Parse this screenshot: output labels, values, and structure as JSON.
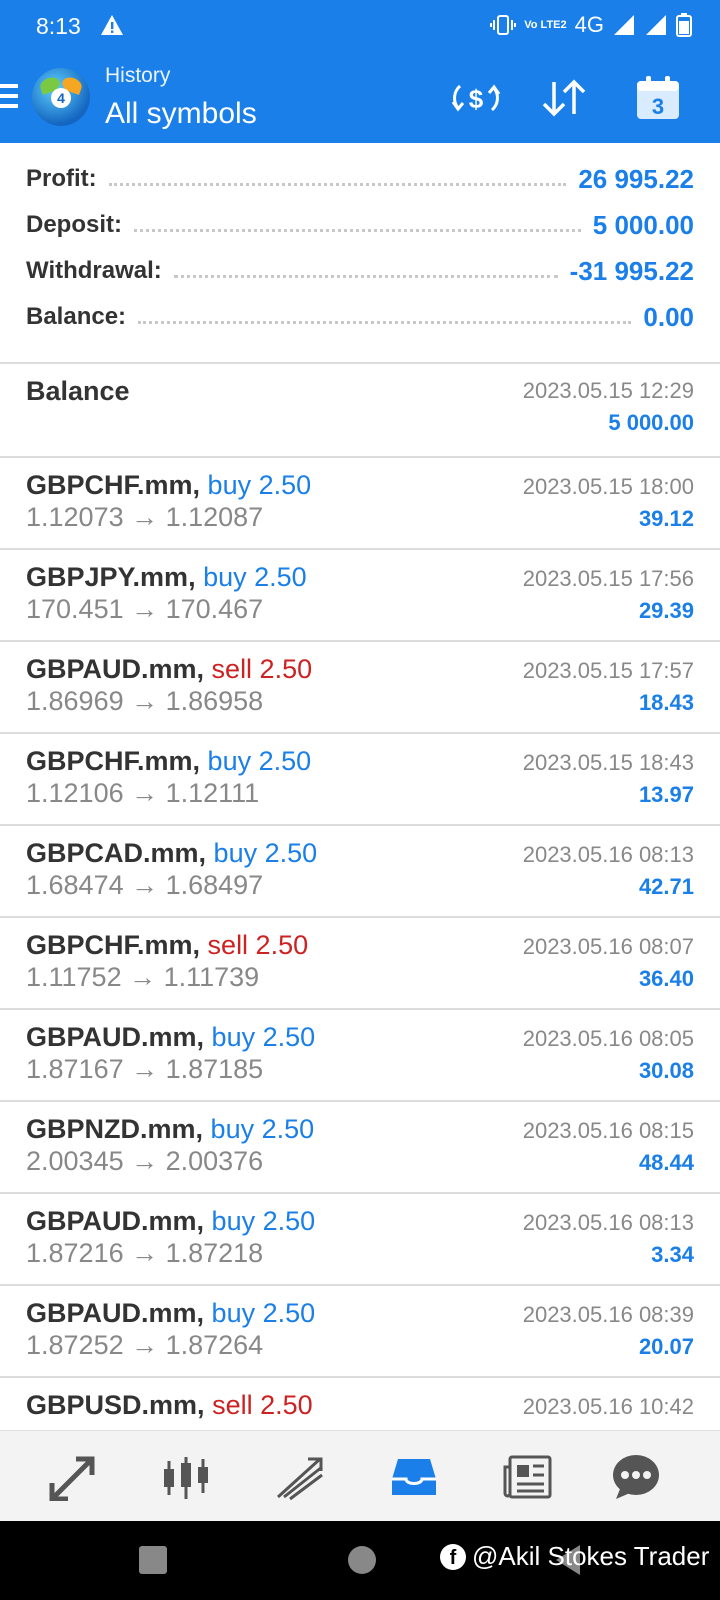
{
  "status_bar": {
    "time": "8:13",
    "network": "4G",
    "volte": "Vo LTE2"
  },
  "header": {
    "subtitle": "History",
    "title": "All symbols",
    "calendar_day": "3"
  },
  "summary": [
    {
      "label": "Profit:",
      "value": "26 995.22"
    },
    {
      "label": "Deposit:",
      "value": "5 000.00"
    },
    {
      "label": "Withdrawal:",
      "value": "-31 995.22"
    },
    {
      "label": "Balance:",
      "value": "0.00"
    }
  ],
  "balance_entry": {
    "title": "Balance",
    "time": "2023.05.15 12:29",
    "amount": "5 000.00"
  },
  "deals": [
    {
      "symbol": "GBPCHF.mm,",
      "side": "buy 2.50",
      "type": "buy",
      "prices": "1.12073 → 1.12087",
      "time": "2023.05.15 18:00",
      "profit": "39.12"
    },
    {
      "symbol": "GBPJPY.mm,",
      "side": "buy 2.50",
      "type": "buy",
      "prices": "170.451 → 170.467",
      "time": "2023.05.15 17:56",
      "profit": "29.39"
    },
    {
      "symbol": "GBPAUD.mm,",
      "side": "sell 2.50",
      "type": "sell",
      "prices": "1.86969 → 1.86958",
      "time": "2023.05.15 17:57",
      "profit": "18.43"
    },
    {
      "symbol": "GBPCHF.mm,",
      "side": "buy 2.50",
      "type": "buy",
      "prices": "1.12106 → 1.12111",
      "time": "2023.05.15 18:43",
      "profit": "13.97"
    },
    {
      "symbol": "GBPCAD.mm,",
      "side": "buy 2.50",
      "type": "buy",
      "prices": "1.68474 → 1.68497",
      "time": "2023.05.16 08:13",
      "profit": "42.71"
    },
    {
      "symbol": "GBPCHF.mm,",
      "side": "sell 2.50",
      "type": "sell",
      "prices": "1.11752 → 1.11739",
      "time": "2023.05.16 08:07",
      "profit": "36.40"
    },
    {
      "symbol": "GBPAUD.mm,",
      "side": "buy 2.50",
      "type": "buy",
      "prices": "1.87167 → 1.87185",
      "time": "2023.05.16 08:05",
      "profit": "30.08"
    },
    {
      "symbol": "GBPNZD.mm,",
      "side": "buy 2.50",
      "type": "buy",
      "prices": "2.00345 → 2.00376",
      "time": "2023.05.16 08:15",
      "profit": "48.44"
    },
    {
      "symbol": "GBPAUD.mm,",
      "side": "buy 2.50",
      "type": "buy",
      "prices": "1.87216 → 1.87218",
      "time": "2023.05.16 08:13",
      "profit": "3.34"
    },
    {
      "symbol": "GBPAUD.mm,",
      "side": "buy 2.50",
      "type": "buy",
      "prices": "1.87252 → 1.87264",
      "time": "2023.05.16 08:39",
      "profit": "20.07"
    },
    {
      "symbol": "GBPUSD.mm,",
      "side": "sell 2.50",
      "type": "sell",
      "prices": "",
      "time": "2023.05.16 10:42",
      "profit": ""
    }
  ],
  "tabs": [
    {
      "icon": "quotes-icon"
    },
    {
      "icon": "chart-icon"
    },
    {
      "icon": "trade-icon"
    },
    {
      "icon": "history-icon",
      "active": true
    },
    {
      "icon": "news-icon"
    },
    {
      "icon": "chat-icon"
    }
  ],
  "watermark": "@Akil Stokes Trader",
  "colors": {
    "accent": "#1a7fe8",
    "sell": "#cc2222",
    "muted": "#888888"
  }
}
